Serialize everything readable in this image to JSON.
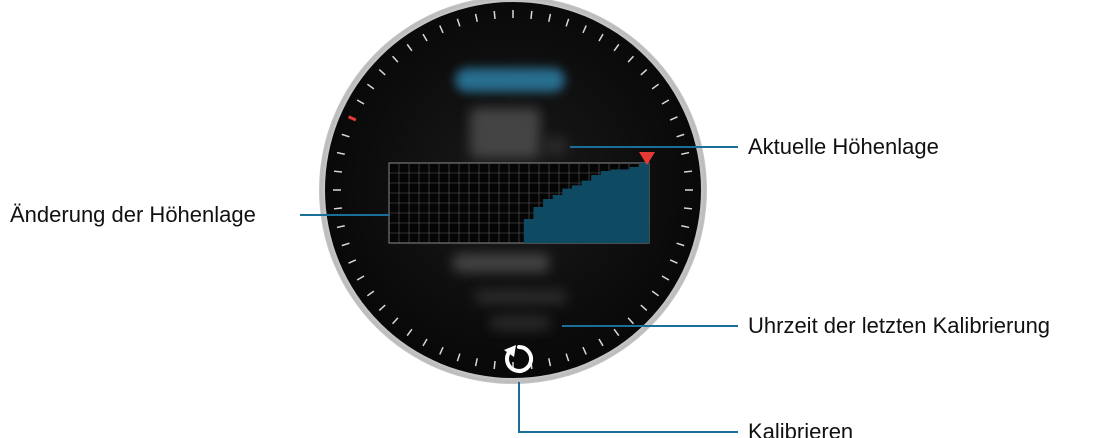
{
  "callouts": {
    "current_altitude": "Aktuelle Höhenlage",
    "altitude_change": "Änderung der Höhenlage",
    "last_calibration_time": "Uhrzeit der letzten Kalibrierung",
    "calibrate": "Kalibrieren"
  },
  "icons": {
    "calibrate": "refresh-icon",
    "current_marker": "red-triangle-marker-icon"
  },
  "colors": {
    "callout_line": "#1a6f9a",
    "graph_fill": "#0f4a63",
    "marker_red": "#e53935",
    "watch_face": "#000000"
  },
  "graph": {
    "step_profile": [
      0,
      0,
      0,
      0,
      0,
      0,
      0,
      0,
      0,
      0,
      0,
      0,
      0,
      0,
      0.3,
      0.45,
      0.55,
      0.6,
      0.68,
      0.72,
      0.78,
      0.85,
      0.9,
      0.92,
      0.92,
      0.95,
      1.0
    ]
  }
}
